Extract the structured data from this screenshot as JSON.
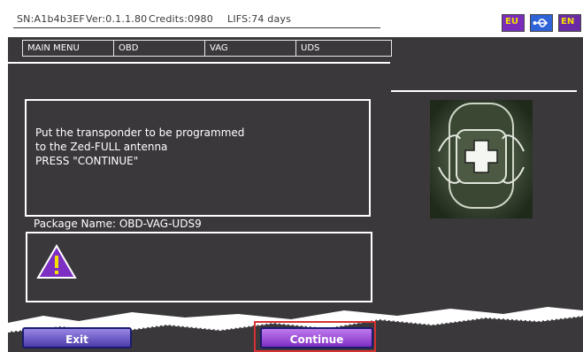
{
  "status": {
    "sn": "SN:A1b4b3EF",
    "version": "Ver:0.1.1.80",
    "credits": "Credits:0980",
    "lifs": "LIFS:74 days",
    "flag_label": "EU",
    "lang_label": "EN"
  },
  "breadcrumb": [
    "MAIN MENU",
    "OBD",
    "VAG",
    "UDS"
  ],
  "message": [
    "Put the transponder to be programmed",
    "to the Zed-FULL antenna",
    "PRESS \"CONTINUE\""
  ],
  "package_label": "Package Name: OBD-VAG-UDS9",
  "buttons": {
    "exit": "Exit",
    "continue": "Continue"
  },
  "colors": {
    "background": "#3b383c",
    "accent": "#7e2fc3",
    "highlight": "#d63232"
  }
}
